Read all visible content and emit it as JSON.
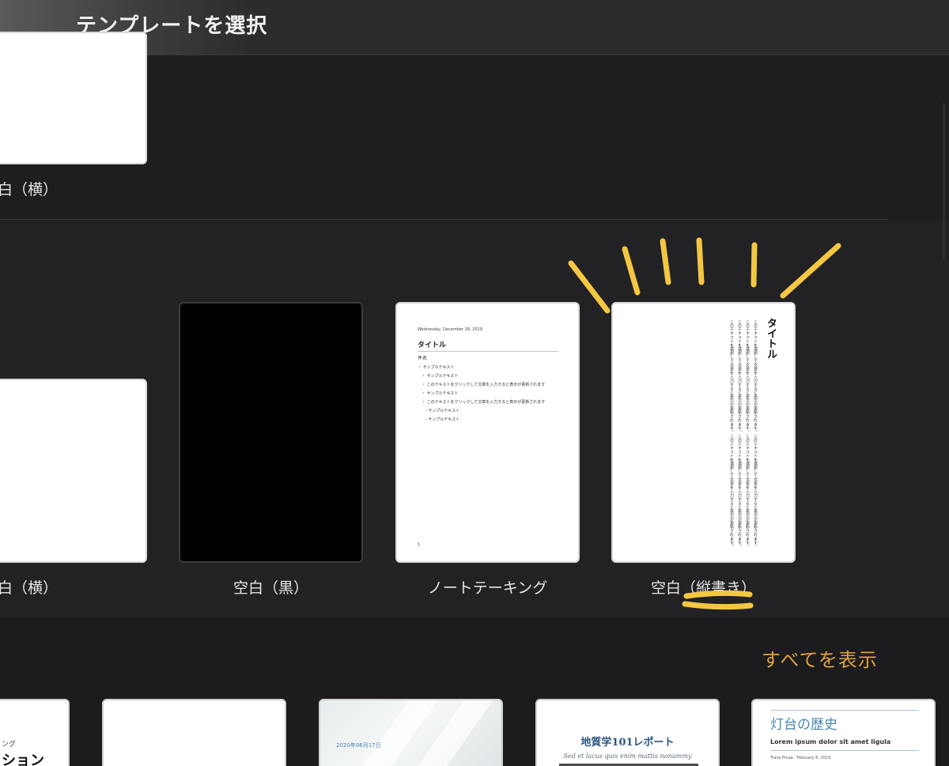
{
  "header": {
    "title": "テンプレートを選択"
  },
  "basic_templates": {
    "top_row": {
      "landscape_label": "白（横）"
    },
    "mid_row": {
      "landscape_label": "白（横）",
      "black_label": "空白（黒）",
      "note_label": "ノートテーキング",
      "vertical_label": "空白（縦書き）"
    }
  },
  "note_thumb": {
    "date": "Wednesday, December 18, 2019",
    "title": "タイトル",
    "subject": "件名",
    "lines": [
      "・ サンプルテキスト",
      "　・ サンプルテキスト",
      "　・ このテキストをクリックして文章を入力すると表示が更新されます",
      "　・ サンプルテキスト",
      "　・ このテキストをクリックして文章を入力すると表示が更新されます",
      "　　- サンプルテキスト",
      "　　- サンプルテキスト"
    ],
    "page_number": "1"
  },
  "vertical_thumb": {
    "title": "タイトル",
    "body": "このテキストを選択して文章を入力すると表示が更新されます。このテキストを選択して文章を入力すると表示が更新されます。このテキストを選択して文章を入力すると表示が更新されます。このテキストを選択して文章を入力すると表示が更新されます。このテキストを選択して文章を入力すると表示が更新されます。このテキストを選択して文章を入力すると表示が更新されます。このテキストを選択して文章を入力すると表示が更新されます。このテキストを選択して文章を入力すると表示が更新されます。"
  },
  "reports": {
    "show_all": "すべてを表示",
    "t1": {
      "small": "ング",
      "big": "ション"
    },
    "t3": {
      "date": "2020年06月17日"
    },
    "t4": {
      "title": "地質学101レポート",
      "subtitle": "Sed et lacus quis enim mattis nonummy"
    },
    "t5": {
      "title": "灯台の歴史",
      "subtitle": "Lorem ipsum dolor sit amet ligula",
      "author": "Tranz Pruza · February 8, 2019"
    }
  },
  "colors": {
    "accent": "#e0a040",
    "annotation": "#f4c742"
  }
}
